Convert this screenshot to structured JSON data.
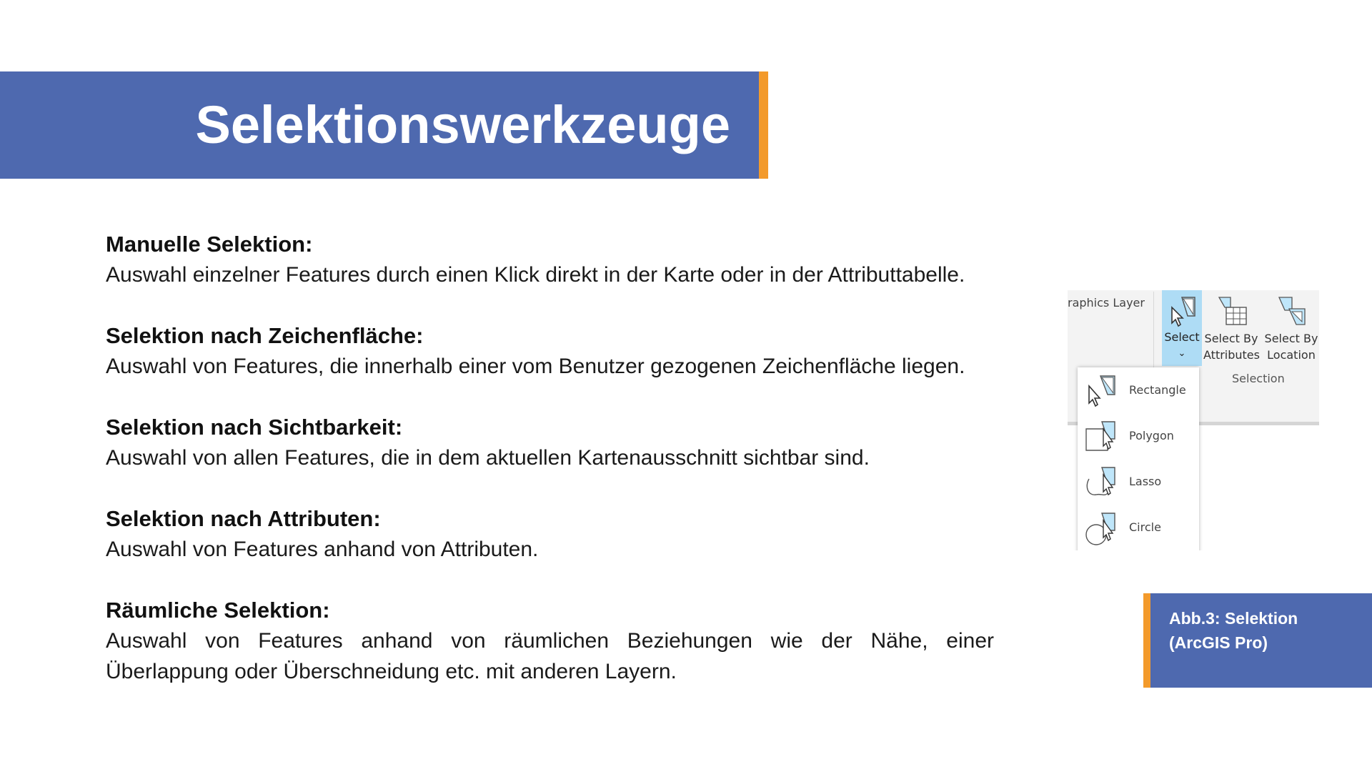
{
  "title": "Selektionswerkzeuge",
  "colors": {
    "banner": "#4E69AF",
    "accent": "#F39A2B",
    "select_highlight": "#AEDCF5"
  },
  "sections": [
    {
      "heading": "Manuelle Selektion:",
      "text": "Auswahl einzelner Features durch einen Klick direkt in der Karte oder in der Attributtabelle."
    },
    {
      "heading": "Selektion nach Zeichenfläche:",
      "text": "Auswahl von Features, die innerhalb einer vom Benutzer gezogenen Zeichenfläche liegen."
    },
    {
      "heading": "Selektion nach Sichtbarkeit:",
      "text": "Auswahl von allen Features, die in dem aktuellen Kartenausschnitt sichtbar sind."
    },
    {
      "heading": "Selektion nach Attributen:",
      "text": "Auswahl von Features anhand von Attributen."
    },
    {
      "heading": "Räumliche Selektion:",
      "text": "Auswahl von Features anhand von räumlichen Beziehungen wie der Nähe, einer Überlappung oder Überschneidung etc. mit anderen Layern."
    }
  ],
  "ribbon": {
    "graphics_layer_label": "raphics Layer",
    "select_label": "Select",
    "select_chevron": "⌄",
    "select_by_attributes": [
      "Select By",
      "Attributes"
    ],
    "select_by_location": [
      "Select By",
      "Location"
    ],
    "group_label": "Selection",
    "dropdown": [
      {
        "label": "Rectangle",
        "icon": "rectangle-select-icon"
      },
      {
        "label": "Polygon",
        "icon": "polygon-select-icon"
      },
      {
        "label": "Lasso",
        "icon": "lasso-select-icon"
      },
      {
        "label": "Circle",
        "icon": "circle-select-icon"
      }
    ]
  },
  "caption": "Abb.3: Selektion (ArcGIS Pro)"
}
